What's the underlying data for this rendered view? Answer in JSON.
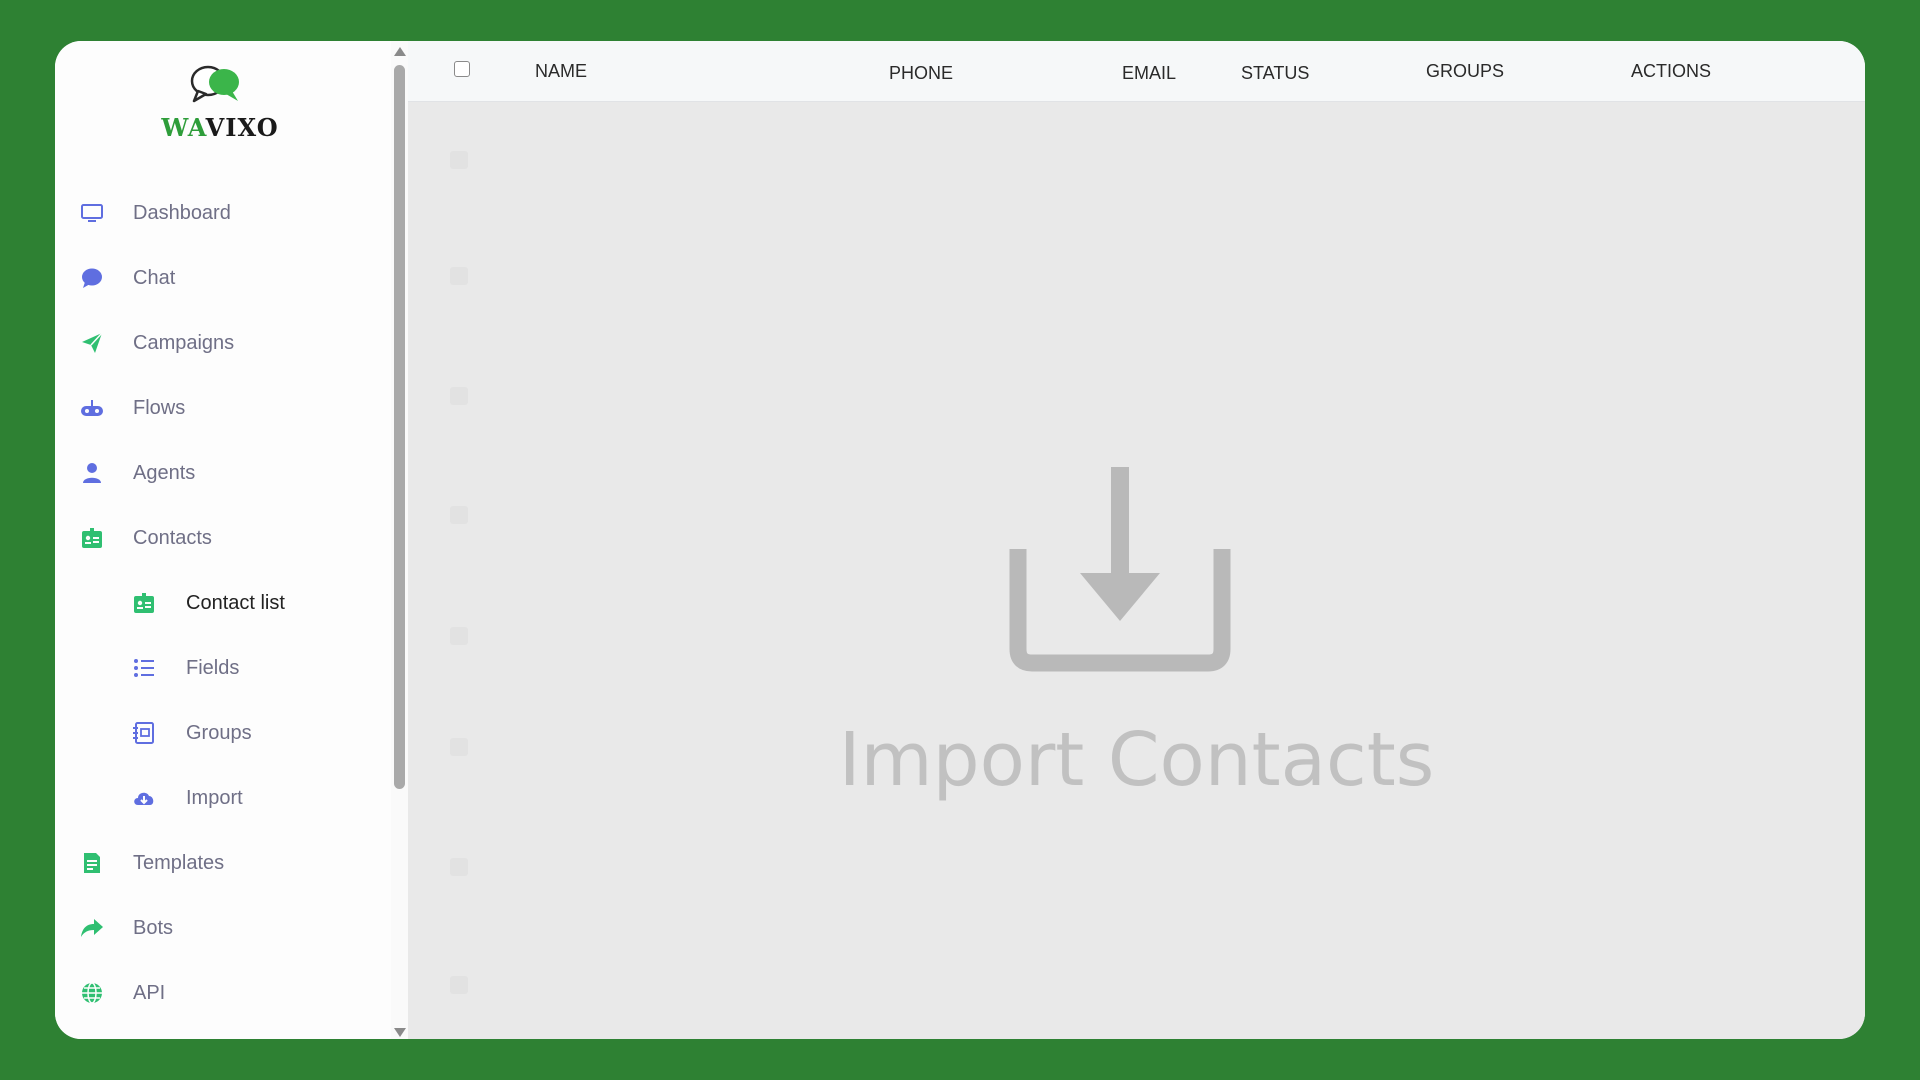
{
  "app": {
    "logo": {
      "prefix": "WA",
      "suffix": "VIXO"
    }
  },
  "sidebar": {
    "items": [
      {
        "label": "Dashboard",
        "icon": "monitor-icon"
      },
      {
        "label": "Chat",
        "icon": "chat-bubble-icon"
      },
      {
        "label": "Campaigns",
        "icon": "paper-plane-icon"
      },
      {
        "label": "Flows",
        "icon": "gamepad-icon"
      },
      {
        "label": "Agents",
        "icon": "user-icon"
      },
      {
        "label": "Contacts",
        "icon": "contact-card-icon"
      },
      {
        "label": "Contact list",
        "icon": "contact-card-icon",
        "active": true
      },
      {
        "label": "Fields",
        "icon": "list-icon"
      },
      {
        "label": "Groups",
        "icon": "address-book-icon"
      },
      {
        "label": "Import",
        "icon": "cloud-upload-icon"
      },
      {
        "label": "Templates",
        "icon": "document-icon"
      },
      {
        "label": "Bots",
        "icon": "share-arrow-icon"
      },
      {
        "label": "API",
        "icon": "globe-icon"
      }
    ]
  },
  "table": {
    "headers": {
      "name": "NAME",
      "phone": "PHONE",
      "email": "EMAIL",
      "status": "STATUS",
      "groups": "GROUPS",
      "actions": "ACTIONS"
    }
  },
  "empty_state": {
    "title": "Import Contacts",
    "icon": "download-tray-icon"
  },
  "colors": {
    "background": "#2e8133",
    "accent_green": "#2fbf71",
    "accent_indigo": "#5f6ee0",
    "muted_text": "#6f6f86"
  }
}
